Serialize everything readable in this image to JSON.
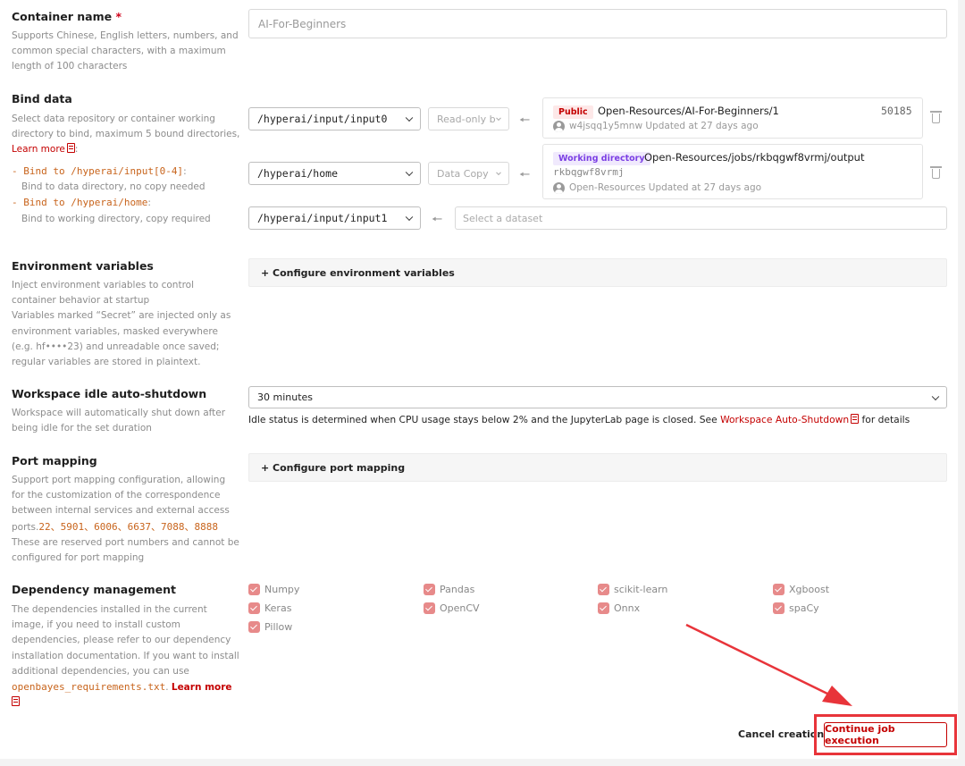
{
  "container_name": {
    "label": "Container name",
    "required_mark": "*",
    "description": "Supports Chinese, English letters, numbers, and common special characters, with a maximum length of 100 characters",
    "value": "AI-For-Beginners"
  },
  "bind_data": {
    "label": "Bind data",
    "description": "Select data repository or container working directory to bind, maximum 5 bound directories,",
    "learn_more": "Learn more",
    "bullets": [
      {
        "prefix": "- ",
        "code": "Bind to /hyperai/input[0-4]",
        "suffix": ":",
        "note": "Bind to data directory, no copy needed"
      },
      {
        "prefix": "- ",
        "code": "Bind to /hyperai/home",
        "suffix": ":",
        "note": "Bind to working directory, copy required"
      }
    ],
    "rows": [
      {
        "path": "/hyperai/input/input0",
        "mode": "Read-only b",
        "badge": "Public",
        "title": "Open-Resources/AI-For-Beginners/1",
        "size": "50185",
        "meta": "w4jsqq1y5mnw Updated at 27 days ago"
      },
      {
        "path": "/hyperai/home",
        "mode": "Data Copy",
        "badge": "Working directory",
        "title": "Open-Resources/jobs/rkbqgwf8vrmj/output",
        "sub": "rkbqgwf8vrmj",
        "meta": "Open-Resources Updated at 27 days ago"
      },
      {
        "path": "/hyperai/input/input1",
        "placeholder": "Select a dataset"
      }
    ]
  },
  "env_vars": {
    "label": "Environment variables",
    "description": "Inject environment variables to control container behavior at startup\nVariables marked “Secret” are injected only as environment variables, masked everywhere (e.g. hf••••23) and unreadable once saved; regular variables are stored in plaintext.",
    "button": "+ Configure environment variables"
  },
  "idle_shutdown": {
    "label": "Workspace idle auto-shutdown",
    "description": "Workspace will automatically shut down after being idle for the set duration",
    "value": "30 minutes",
    "note_prefix": "Idle status is determined when CPU usage stays below 2% and the JupyterLab page is closed. See ",
    "note_link": "Workspace Auto-Shutdown",
    "note_suffix": " for details"
  },
  "port_mapping": {
    "label": "Port mapping",
    "description": "Support port mapping configuration, allowing for the customization of the correspondence between internal services and external access ports.",
    "ports": "22、5901、6006、6637、7088、8888",
    "description2": "These are reserved port numbers and cannot be configured for port mapping",
    "button": "+ Configure port mapping"
  },
  "dependencies": {
    "label": "Dependency management",
    "description": "The dependencies installed in the current image, if you need to install custom dependencies, please refer to our dependency installation documentation. If you want to install additional dependencies, you can use",
    "file": "openbayes_requirements.txt",
    "dot": ".",
    "learn_more": "Learn more",
    "items": [
      "Numpy",
      "Pandas",
      "scikit-learn",
      "Xgboost",
      "Keras",
      "OpenCV",
      "Onnx",
      "spaCy",
      "Pillow"
    ]
  },
  "footer": {
    "cancel": "Cancel creation",
    "continue": "Continue job execution"
  },
  "colors": {
    "accent": "#c40000",
    "highlight": "#e8343a",
    "public_badge_bg": "#fde8e8",
    "workdir_badge_bg": "#f0e9fd"
  }
}
